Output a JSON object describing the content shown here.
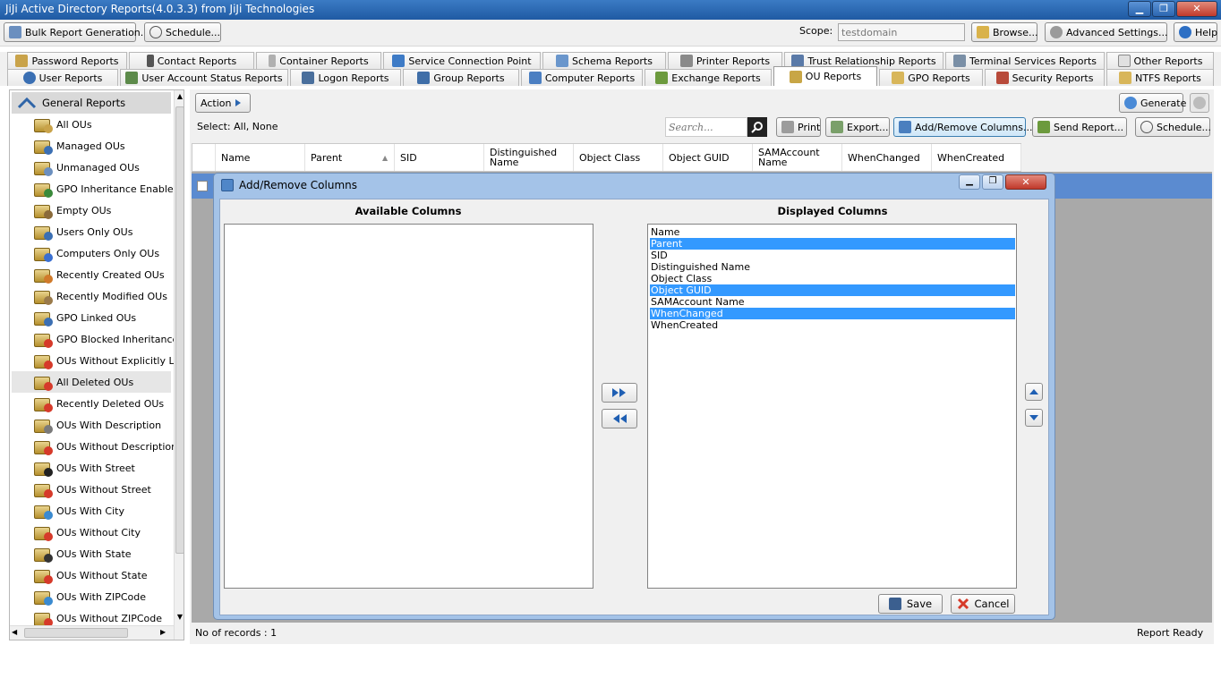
{
  "window": {
    "title": "JiJi Active Directory Reports(4.0.3.3) from JiJi Technologies",
    "min_label": "▁",
    "max_label": "❐",
    "close_label": "✕"
  },
  "toolbar": {
    "bulk_label": "Bulk Report Generation...",
    "schedule_label": "Schedule...",
    "scope_label": "Scope:",
    "scope_value": "testdomain",
    "browse_label": "Browse...",
    "advanced_label": "Advanced Settings...",
    "help_label": "Help"
  },
  "tabs_top": [
    {
      "label": "Password Reports"
    },
    {
      "label": "Contact Reports"
    },
    {
      "label": "Container Reports"
    },
    {
      "label": "Service Connection Point"
    },
    {
      "label": "Schema Reports"
    },
    {
      "label": "Printer Reports"
    },
    {
      "label": "Trust Relationship Reports"
    },
    {
      "label": "Terminal Services Reports"
    },
    {
      "label": "Other Reports"
    }
  ],
  "tabs_bottom": [
    {
      "label": "User Reports"
    },
    {
      "label": "User Account Status Reports"
    },
    {
      "label": "Logon Reports"
    },
    {
      "label": "Group Reports"
    },
    {
      "label": "Computer Reports"
    },
    {
      "label": "Exchange Reports"
    },
    {
      "label": "OU Reports"
    },
    {
      "label": "GPO Reports"
    },
    {
      "label": "Security Reports"
    },
    {
      "label": "NTFS Reports"
    }
  ],
  "active_tab": "OU Reports",
  "sidebar": {
    "header": "General Reports",
    "items": [
      {
        "label": "All OUs"
      },
      {
        "label": "Managed OUs"
      },
      {
        "label": "Unmanaged OUs"
      },
      {
        "label": "GPO Inheritance Enabled"
      },
      {
        "label": "Empty OUs"
      },
      {
        "label": "Users Only OUs"
      },
      {
        "label": "Computers Only OUs"
      },
      {
        "label": "Recently Created OUs"
      },
      {
        "label": "Recently Modified OUs"
      },
      {
        "label": "GPO Linked OUs"
      },
      {
        "label": "GPO Blocked Inheritance"
      },
      {
        "label": "OUs Without Explicitly Linl"
      },
      {
        "label": "All Deleted OUs"
      },
      {
        "label": "Recently Deleted OUs"
      },
      {
        "label": "OUs With Description"
      },
      {
        "label": "OUs Without Description"
      },
      {
        "label": "OUs With Street"
      },
      {
        "label": "OUs Without Street"
      },
      {
        "label": "OUs With City"
      },
      {
        "label": "OUs Without City"
      },
      {
        "label": "OUs With State"
      },
      {
        "label": "OUs Without State"
      },
      {
        "label": "OUs With ZIPCode"
      },
      {
        "label": "OUs Without ZIPCode"
      }
    ],
    "selected": "All Deleted OUs"
  },
  "main": {
    "action_label": "Action",
    "generate_label": "Generate",
    "select_text": "Select:  All,  None",
    "search_placeholder": "Search...",
    "print_label": "Print",
    "export_label": "Export...",
    "add_remove_label": "Add/Remove Columns...",
    "send_report_label": "Send Report...",
    "schedule_label": "Schedule...",
    "columns": [
      "Name",
      "Parent",
      "SID",
      "Distinguished Name",
      "Object Class",
      "Object GUID",
      "SAMAccount Name",
      "WhenChanged",
      "WhenCreated"
    ],
    "records_text": "No of records : 1",
    "status_text": "Report Ready"
  },
  "dialog": {
    "title": "Add/Remove Columns",
    "available_heading": "Available Columns",
    "displayed_heading": "Displayed Columns",
    "available_items": [],
    "displayed_items": [
      {
        "label": "Name",
        "selected": false
      },
      {
        "label": "Parent",
        "selected": true
      },
      {
        "label": "SID",
        "selected": false
      },
      {
        "label": "Distinguished Name",
        "selected": false
      },
      {
        "label": "Object Class",
        "selected": false
      },
      {
        "label": "Object GUID",
        "selected": true
      },
      {
        "label": "SAMAccount Name",
        "selected": false
      },
      {
        "label": "WhenChanged",
        "selected": true
      },
      {
        "label": "WhenCreated",
        "selected": false
      }
    ],
    "save_label": "Save",
    "cancel_label": "Cancel"
  },
  "colors": {
    "titlebar": "#2563ad",
    "selection": "#3399ff",
    "dialog_frame": "#a4c3e8"
  }
}
